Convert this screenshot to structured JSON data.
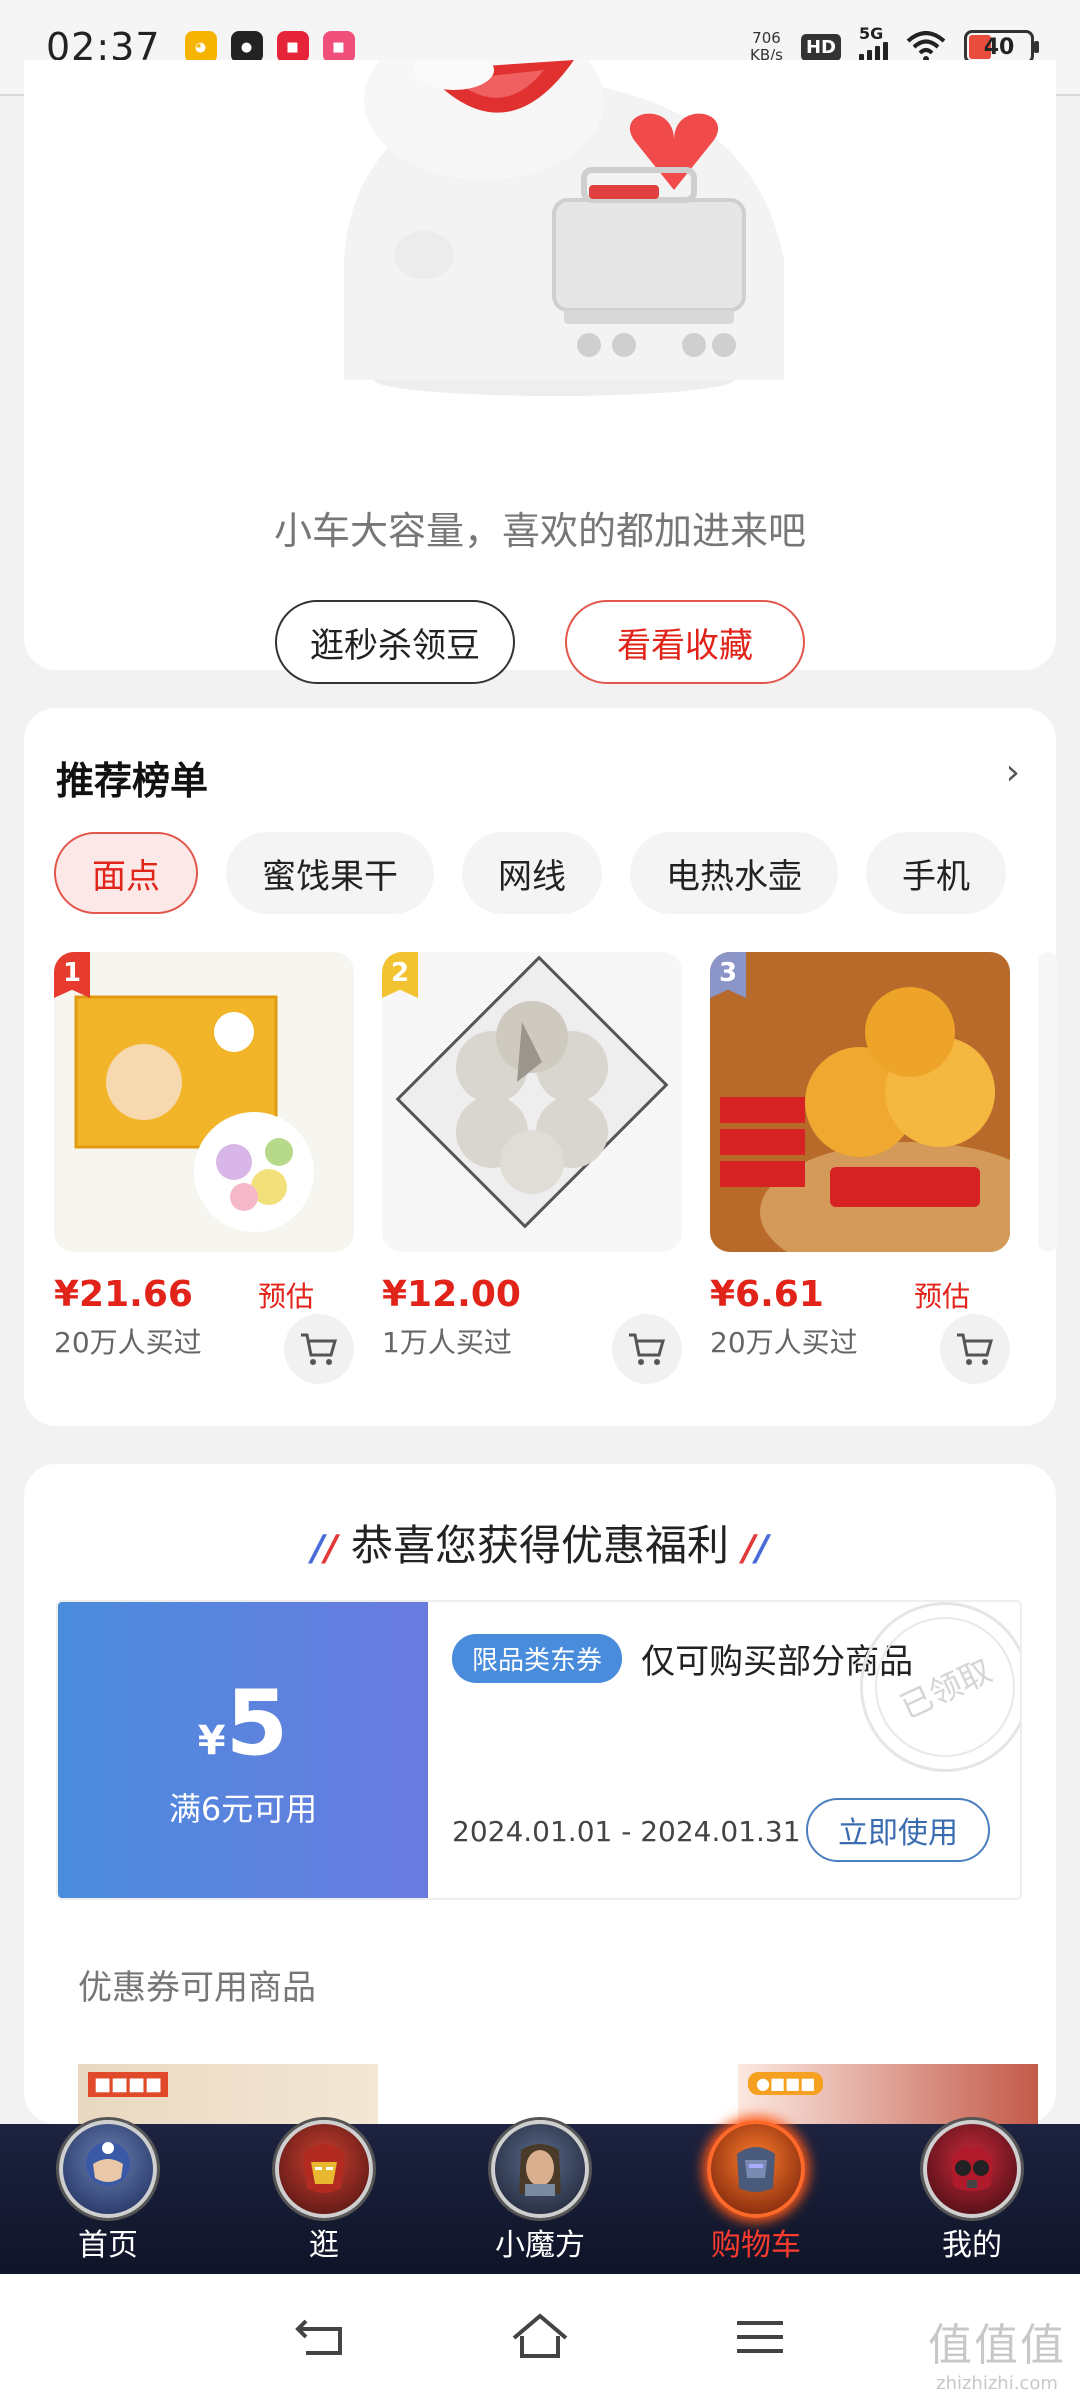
{
  "status_bar": {
    "time": "02:37",
    "speed_value": "706",
    "speed_unit": "KB/s",
    "hd": "HD",
    "network": "5G",
    "battery": "40"
  },
  "empty_cart": {
    "message": "小车大容量，喜欢的都加进来吧",
    "btn_seckill": "逛秒杀领豆",
    "btn_favorites": "看看收藏"
  },
  "recommend": {
    "title": "推荐榜单",
    "arrow": "›",
    "categories": [
      "面点",
      "蜜饯果干",
      "网线",
      "电热水壶",
      "手机"
    ],
    "products": [
      {
        "rank": "1",
        "price": "¥21.66",
        "tag": "预估",
        "sold": "20万人买过"
      },
      {
        "rank": "2",
        "price": "¥12.00",
        "tag": "",
        "sold": "1万人买过"
      },
      {
        "rank": "3",
        "price": "¥6.61",
        "tag": "预估",
        "sold": "20万人买过"
      }
    ]
  },
  "coupon": {
    "title": "恭喜您获得优惠福利",
    "currency": "¥",
    "amount": "5",
    "condition": "满6元可用",
    "tag": "限品类东券",
    "description": "仅可购买部分商品",
    "date_range": "2024.01.01 - 2024.01.31",
    "use_button": "立即使用",
    "stamp": "已领取",
    "available_title": "优惠券可用商品"
  },
  "bottom_nav": [
    {
      "label": "首页"
    },
    {
      "label": "逛"
    },
    {
      "label": "小魔方"
    },
    {
      "label": "购物车"
    },
    {
      "label": "我的"
    }
  ],
  "watermark": {
    "big": "值值值",
    "small": "zhizhizhi.com"
  },
  "colors": {
    "accent_red": "#e2231a",
    "coupon_blue": "#4a8cdc",
    "nav_bg": "#1d2340"
  }
}
